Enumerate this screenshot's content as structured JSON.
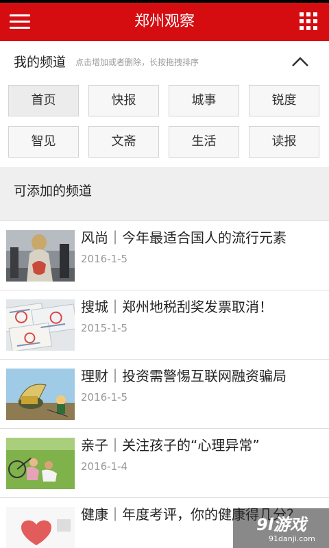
{
  "app": {
    "title": "郑州观察",
    "accent": "#d50d11"
  },
  "icons": {
    "menu": "hamburger-menu-icon",
    "grid": "grid-apps-icon",
    "collapse": "chevron-up-icon"
  },
  "my_channels": {
    "title": "我的频道",
    "hint": "点击增加或者删除，长按拖拽排序",
    "channels": [
      "首页",
      "快报",
      "城事",
      "锐度",
      "智见",
      "文斋",
      "生活",
      "读报"
    ]
  },
  "addable": {
    "title": "可添加的频道"
  },
  "articles": [
    {
      "title": "风尚｜今年最适合国人的流行元素",
      "date": "2016-1-5"
    },
    {
      "title": "搜城｜郑州地税刮奖发票取消！",
      "date": "2015-1-5"
    },
    {
      "title": "理财｜投资需警惕互联网融资骗局",
      "date": "2016-1-5"
    },
    {
      "title": "亲子｜关注孩子的“心理异常”",
      "date": "2016-1-4"
    },
    {
      "title": "健康｜年度考评，你的健康得几分？",
      "date": ""
    }
  ],
  "watermark": {
    "logo": "9l游戏",
    "url": "91danji.com"
  }
}
